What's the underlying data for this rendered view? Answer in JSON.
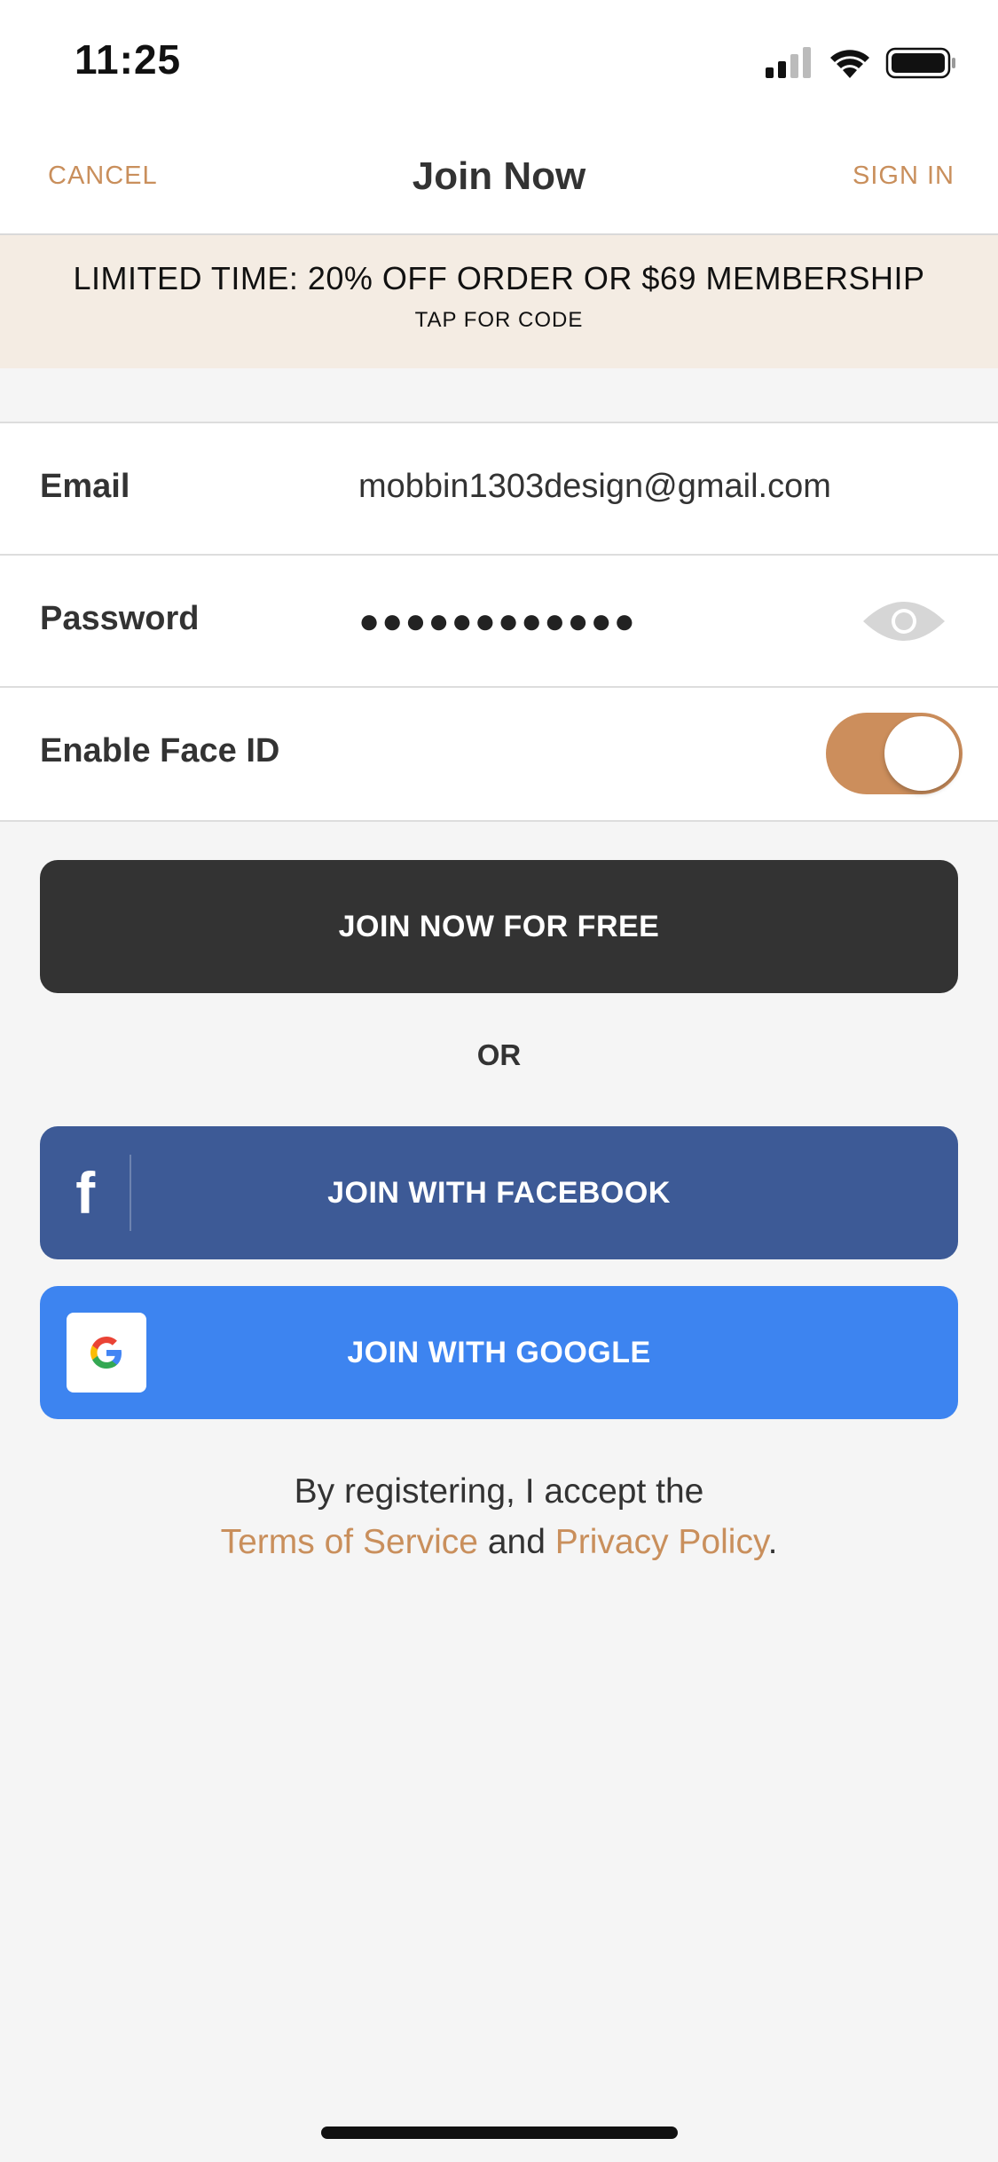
{
  "status_bar": {
    "time": "11:25"
  },
  "nav": {
    "cancel_label": "CANCEL",
    "title": "Join Now",
    "signin_label": "SIGN IN",
    "accent_color": "#c98f5c"
  },
  "promo": {
    "title": "LIMITED TIME: 20% OFF ORDER OR $69 MEMBERSHIP",
    "subtitle": "TAP FOR CODE",
    "background": "#f4ece3"
  },
  "form": {
    "email": {
      "label": "Email",
      "value": "mobbin1303design@gmail.com"
    },
    "password": {
      "label": "Password",
      "masked_value": "●●●●●●●●●●●●",
      "reveal_icon": "eye-icon"
    },
    "face_id": {
      "label": "Enable Face ID",
      "enabled": true,
      "toggle_color": "#cc8e5c"
    }
  },
  "actions": {
    "join_free_label": "JOIN NOW FOR FREE",
    "or_label": "OR",
    "facebook_label": "JOIN WITH FACEBOOK",
    "facebook_icon": "facebook-icon",
    "facebook_color": "#3d5a96",
    "google_label": "JOIN WITH GOOGLE",
    "google_icon": "google-icon",
    "google_color": "#3d84f0"
  },
  "terms": {
    "prefix": "By registering, I accept the",
    "tos_label": "Terms of Service",
    "and_text": " and ",
    "privacy_label": "Privacy Policy",
    "suffix": "."
  }
}
